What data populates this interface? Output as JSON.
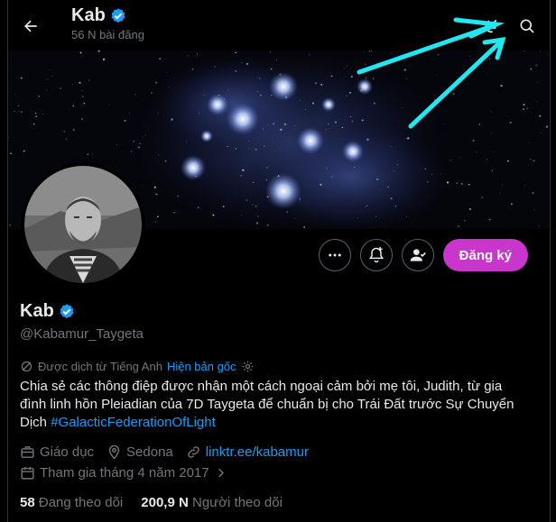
{
  "header": {
    "name": "Kab",
    "post_count": "56 N bài đăng",
    "icons": [
      "back-arrow-icon",
      "grok-icon",
      "search-icon"
    ]
  },
  "profile": {
    "name": "Kab",
    "handle": "@Kabamur_Taygeta",
    "verified": true,
    "accent_color": "#1d9bf0",
    "subscribe_label": "Đăng ký",
    "subscribe_color": "#c936cc"
  },
  "translation": {
    "label": "Được dịch từ Tiếng Anh",
    "show_original": "Hiện bản gốc"
  },
  "bio": {
    "line1": "Chia sẻ các thông điệp được nhận một cách ngoại cảm bởi mẹ tôi, Judith, từ gia",
    "line2": "đình linh hồn Pleiadian của 7D Taygeta để chuẩn bị cho Trái Đất trước Sự Chuyển",
    "line3_text": "Dịch ",
    "hashtag": "#GalacticFederationOfLight"
  },
  "meta": {
    "category": "Giáo dục",
    "location": "Sedona",
    "link": "linktr.ee/kabamur",
    "joined": "Tham gia tháng 4 năm 2017"
  },
  "stats": {
    "following_count": "58",
    "following_label": "Đang theo dõi",
    "followers_count": "200,9 N",
    "followers_label": "Người theo dõi"
  }
}
